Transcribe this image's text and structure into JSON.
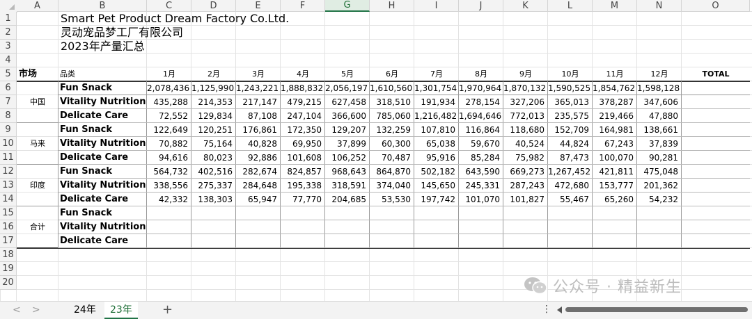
{
  "columns": [
    "A",
    "B",
    "C",
    "D",
    "E",
    "F",
    "G",
    "H",
    "I",
    "J",
    "K",
    "L",
    "M",
    "N",
    "O"
  ],
  "selected_column": "G",
  "rows": [
    "1",
    "2",
    "3",
    "4",
    "5",
    "6",
    "7",
    "8",
    "9",
    "10",
    "11",
    "12",
    "13",
    "14",
    "15",
    "16",
    "17",
    "18",
    "19",
    "20"
  ],
  "title": {
    "line1": "Smart Pet Product Dream Factory Co.Ltd.",
    "line2": "灵动宠品梦工厂有限公司",
    "line3": "2023年产量汇总"
  },
  "header": {
    "market": "市场",
    "category": "品类",
    "months": [
      "1月",
      "2月",
      "3月",
      "4月",
      "5月",
      "6月",
      "7月",
      "8月",
      "9月",
      "10月",
      "11月",
      "12月"
    ],
    "total": "TOTAL"
  },
  "markets": [
    {
      "name": "中国",
      "rows": [
        {
          "category": "Fun Snack",
          "values": [
            "2,078,436",
            "1,125,990",
            "1,243,221",
            "1,888,832",
            "2,056,197",
            "1,610,560",
            "1,301,754",
            "1,970,964",
            "1,870,132",
            "1,590,525",
            "1,854,762",
            "1,598,128"
          ]
        },
        {
          "category": "Vitality Nutrition",
          "values": [
            "435,288",
            "214,353",
            "217,147",
            "479,215",
            "627,458",
            "318,510",
            "191,934",
            "278,154",
            "327,206",
            "365,013",
            "378,287",
            "347,606"
          ]
        },
        {
          "category": "Delicate Care",
          "values": [
            "72,552",
            "129,834",
            "87,108",
            "247,104",
            "366,600",
            "785,060",
            "1,216,482",
            "1,694,646",
            "772,013",
            "235,575",
            "219,466",
            "47,880"
          ]
        }
      ]
    },
    {
      "name": "马来",
      "rows": [
        {
          "category": "Fun Snack",
          "values": [
            "122,649",
            "120,251",
            "176,861",
            "172,350",
            "129,207",
            "132,259",
            "107,810",
            "116,864",
            "118,680",
            "152,709",
            "164,981",
            "138,661"
          ]
        },
        {
          "category": "Vitality Nutrition",
          "values": [
            "70,882",
            "75,164",
            "40,828",
            "69,950",
            "37,899",
            "60,300",
            "65,038",
            "59,670",
            "40,524",
            "44,824",
            "67,243",
            "37,839"
          ]
        },
        {
          "category": "Delicate Care",
          "values": [
            "94,616",
            "80,023",
            "92,886",
            "101,608",
            "106,252",
            "70,487",
            "95,916",
            "85,284",
            "75,982",
            "87,473",
            "100,070",
            "90,281"
          ]
        }
      ]
    },
    {
      "name": "印度",
      "rows": [
        {
          "category": "Fun Snack",
          "values": [
            "564,732",
            "402,516",
            "282,674",
            "824,857",
            "968,643",
            "864,870",
            "502,182",
            "643,590",
            "669,273",
            "1,267,452",
            "421,811",
            "475,048"
          ]
        },
        {
          "category": "Vitality Nutrition",
          "values": [
            "338,556",
            "275,337",
            "284,648",
            "195,338",
            "318,591",
            "374,040",
            "145,650",
            "245,331",
            "287,243",
            "472,680",
            "153,777",
            "201,362"
          ]
        },
        {
          "category": "Delicate Care",
          "values": [
            "42,332",
            "138,303",
            "65,947",
            "77,770",
            "204,685",
            "53,530",
            "197,742",
            "101,070",
            "101,827",
            "55,467",
            "65,260",
            "54,232"
          ]
        }
      ]
    },
    {
      "name": "合计",
      "rows": [
        {
          "category": "Fun Snack",
          "values": [
            "",
            "",
            "",
            "",
            "",
            "",
            "",
            "",
            "",
            "",
            "",
            ""
          ]
        },
        {
          "category": "Vitality Nutrition",
          "values": [
            "",
            "",
            "",
            "",
            "",
            "",
            "",
            "",
            "",
            "",
            "",
            ""
          ]
        },
        {
          "category": "Delicate Care",
          "values": [
            "",
            "",
            "",
            "",
            "",
            "",
            "",
            "",
            "",
            "",
            "",
            ""
          ]
        }
      ]
    }
  ],
  "tabs": [
    {
      "label": "24年",
      "active": false
    },
    {
      "label": "23年",
      "active": true
    }
  ],
  "nav": {
    "prev": "<",
    "next": ">",
    "add": "+",
    "more": "⋮"
  },
  "watermark": {
    "text": "公众号 · 精益新生",
    "icon": "wechat-icon"
  },
  "colors": {
    "accent": "#217346",
    "grid": "#e3e3e3",
    "header_bg": "#f3f3f3"
  }
}
